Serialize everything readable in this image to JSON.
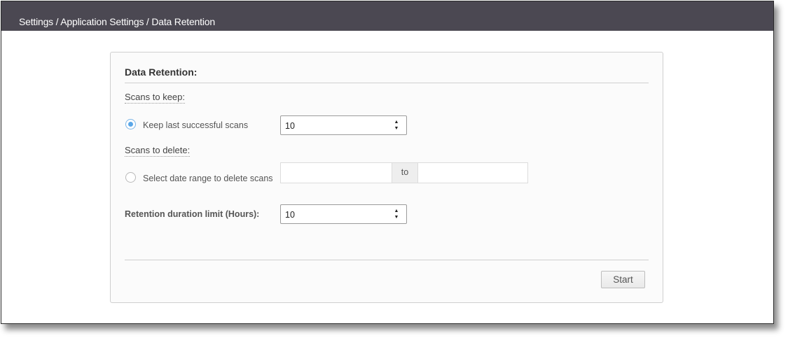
{
  "header": {
    "breadcrumb": "Settings / Application Settings / Data Retention"
  },
  "panel": {
    "title": "Data Retention:",
    "scans_to_keep": {
      "label": "Scans to keep:",
      "option_label": "Keep last successful scans",
      "selected": true,
      "value": "10"
    },
    "scans_to_delete": {
      "label": "Scans to delete:",
      "option_label": "Select date range to delete scans",
      "selected": false,
      "from_value": "",
      "separator": "to",
      "to_value": ""
    },
    "retention_limit": {
      "label": "Retention duration limit (Hours):",
      "value": "10"
    },
    "start_button": "Start"
  },
  "icons": {
    "spin_up": "caret-up-icon",
    "spin_down": "caret-down-icon"
  }
}
